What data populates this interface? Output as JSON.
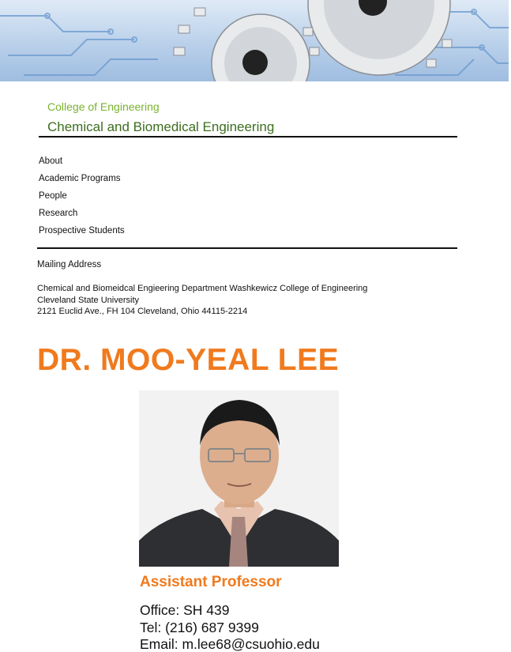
{
  "header": {
    "college": "College of Engineering",
    "department": "Chemical and Biomedical Engineering"
  },
  "nav": {
    "items": [
      "About",
      "Academic Programs",
      "People",
      "Research",
      "Prospective Students"
    ]
  },
  "mailing": {
    "title": "Mailing Address",
    "lines": [
      "Chemical and Biomeidcal Engieering Department Washkewicz College of Engineering",
      "Cleveland State University",
      "2121 Euclid Ave., FH 104 Cleveland, Ohio 44115-2214"
    ]
  },
  "profile": {
    "name": "DR. MOO-YEAL LEE",
    "title": "Assistant Professor",
    "office": "Office: SH 439",
    "tel": "Tel: (216) 687 9399",
    "email": "Email: m.lee68@csuohio.edu"
  },
  "colors": {
    "accent_orange": "#f07a1e",
    "college_green": "#7bb32e",
    "dept_green": "#3c6e1f"
  }
}
